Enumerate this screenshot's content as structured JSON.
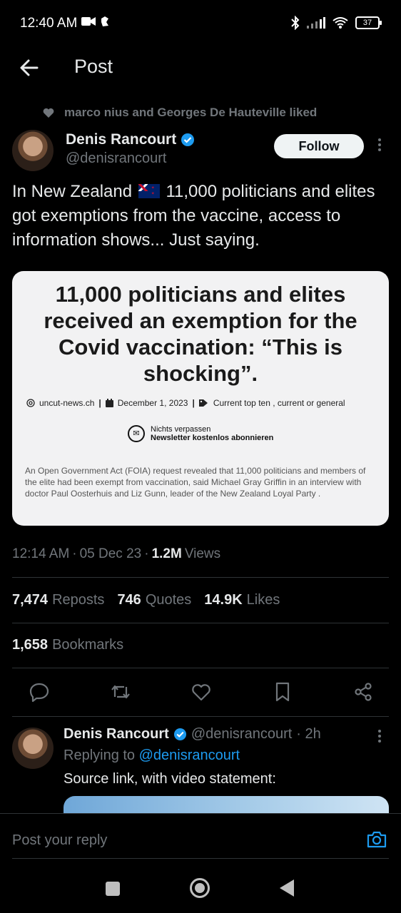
{
  "status_bar": {
    "time": "12:40 AM",
    "battery": "37"
  },
  "header": {
    "title": "Post"
  },
  "social_context": {
    "text": "marco nius and Georges De Hauteville liked"
  },
  "author": {
    "name": "Denis Rancourt",
    "handle": "@denisrancourt"
  },
  "follow_label": "Follow",
  "tweet": {
    "text_before_flag": "In New Zealand",
    "text_after_flag": "11,000 politicians and elites got exemptions from the vaccine, access to information shows... Just saying."
  },
  "card": {
    "headline": "11,000 politicians and elites received an exemption for the Covid vaccination: “This is shocking”.",
    "source": "uncut-news.ch",
    "date": "December 1, 2023",
    "category": "Current top ten , current or general",
    "newsletter_line1": "Nichts verpassen",
    "newsletter_line2": "Newsletter kostenlos abonnieren",
    "body": "An Open Government Act (FOIA) request revealed that 11,000 politicians and members of the elite had been exempt from vaccination, said Michael Gray Griffin in an interview with doctor Paul Oosterhuis and Liz Gunn, leader of the New Zealand Loyal Party ."
  },
  "meta": {
    "time": "12:14 AM",
    "date": "05 Dec 23",
    "views_count": "1.2M",
    "views_label": "Views"
  },
  "stats": {
    "reposts_count": "7,474",
    "reposts_label": "Reposts",
    "quotes_count": "746",
    "quotes_label": "Quotes",
    "likes_count": "14.9K",
    "likes_label": "Likes",
    "bookmarks_count": "1,658",
    "bookmarks_label": "Bookmarks"
  },
  "reply": {
    "name": "Denis Rancourt",
    "handle": "@denisrancourt",
    "age": "· 2h",
    "replying_prefix": "Replying to",
    "replying_handle": "@denisrancourt",
    "text": "Source link, with video statement:"
  },
  "composer": {
    "placeholder": "Post your reply"
  },
  "colors": {
    "accent": "#1d9bf0",
    "background": "#000000",
    "muted": "#71767b"
  },
  "icons": [
    "back-arrow-icon",
    "heart-icon",
    "verified-badge-icon",
    "more-icon",
    "reply-icon",
    "repost-icon",
    "like-icon",
    "bookmark-icon",
    "share-icon",
    "camera-icon"
  ]
}
